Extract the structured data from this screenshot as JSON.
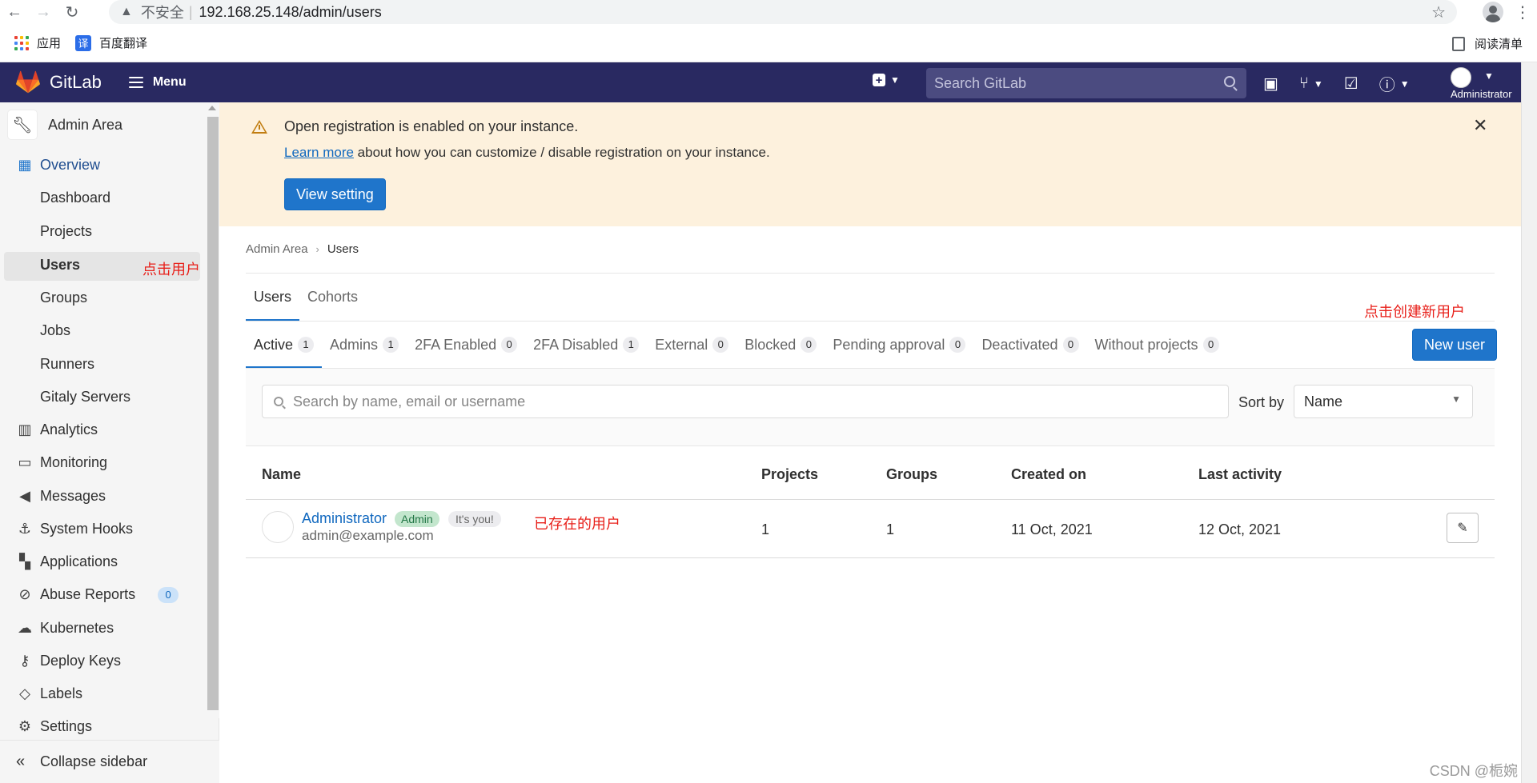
{
  "browser": {
    "url": "192.168.25.148/admin/users",
    "insecure_label": "不安全",
    "bookmarks": [
      {
        "label": "应用"
      },
      {
        "label": "百度翻译",
        "icon_text": "译"
      }
    ],
    "reading_list": "阅读清单",
    "apps_grid_colors": [
      "#ea4335",
      "#fbbc05",
      "#34a853",
      "#4285f4",
      "#ea4335",
      "#fbbc05",
      "#34a853",
      "#4285f4",
      "#ea4335"
    ]
  },
  "navbar": {
    "brand": "GitLab",
    "menu_label": "Menu",
    "search_placeholder": "Search GitLab",
    "user_label": "Administrator",
    "bg_color": "#292961"
  },
  "sidebar": {
    "header": "Admin Area",
    "overview": "Overview",
    "subitems": [
      "Dashboard",
      "Projects",
      "Users",
      "Groups",
      "Jobs",
      "Runners",
      "Gitaly Servers"
    ],
    "items": [
      {
        "label": "Analytics",
        "icon": "chart-icon"
      },
      {
        "label": "Monitoring",
        "icon": "monitor-icon"
      },
      {
        "label": "Messages",
        "icon": "bullhorn-icon"
      },
      {
        "label": "System Hooks",
        "icon": "hook-icon"
      },
      {
        "label": "Applications",
        "icon": "applications-icon"
      },
      {
        "label": "Abuse Reports",
        "icon": "abuse-icon",
        "badge": "0"
      },
      {
        "label": "Kubernetes",
        "icon": "cloud-icon"
      },
      {
        "label": "Deploy Keys",
        "icon": "key-icon"
      },
      {
        "label": "Labels",
        "icon": "label-icon"
      },
      {
        "label": "Settings",
        "icon": "gear-icon"
      }
    ],
    "collapse": "Collapse sidebar",
    "note_users": "点击用户"
  },
  "banner": {
    "title": "Open registration is enabled on your instance.",
    "link": "Learn more",
    "text": " about how you can customize / disable registration on your instance.",
    "button": "View setting"
  },
  "breadcrumb": {
    "parent": "Admin Area",
    "current": "Users"
  },
  "top_tabs": [
    "Users",
    "Cohorts"
  ],
  "filter_tabs": [
    {
      "label": "Active",
      "count": "1"
    },
    {
      "label": "Admins",
      "count": "1"
    },
    {
      "label": "2FA Enabled",
      "count": "0"
    },
    {
      "label": "2FA Disabled",
      "count": "1"
    },
    {
      "label": "External",
      "count": "0"
    },
    {
      "label": "Blocked",
      "count": "0"
    },
    {
      "label": "Pending approval",
      "count": "0"
    },
    {
      "label": "Deactivated",
      "count": "0"
    },
    {
      "label": "Without projects",
      "count": "0"
    }
  ],
  "new_user": {
    "label": "New user",
    "note": "点击创建新用户"
  },
  "filters": {
    "search_placeholder": "Search by name, email or username",
    "sort_label": "Sort by",
    "sort_value": "Name"
  },
  "table": {
    "headers": [
      "Name",
      "Projects",
      "Groups",
      "Created on",
      "Last activity"
    ],
    "rows": [
      {
        "name": "Administrator",
        "badge_admin": "Admin",
        "badge_you": "It's you!",
        "email": "admin@example.com",
        "projects": "1",
        "groups": "1",
        "created": "11 Oct, 2021",
        "last_activity": "12 Oct, 2021",
        "note": "已存在的用户"
      }
    ]
  },
  "watermark": "CSDN @栀婉"
}
